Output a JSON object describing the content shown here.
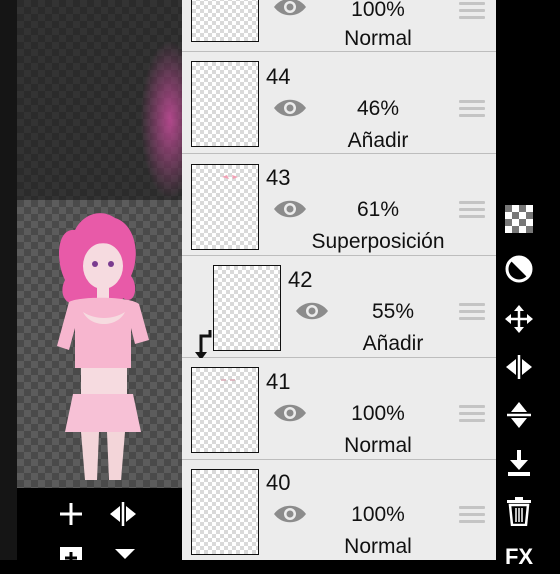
{
  "layers": [
    {
      "number": "",
      "opacity": "100%",
      "blend": "Normal"
    },
    {
      "number": "44",
      "opacity": "46%",
      "blend": "Añadir"
    },
    {
      "number": "43",
      "opacity": "61%",
      "blend": "Superposición"
    },
    {
      "number": "42",
      "opacity": "55%",
      "blend": "Añadir",
      "clipped": true
    },
    {
      "number": "41",
      "opacity": "100%",
      "blend": "Normal"
    },
    {
      "number": "40",
      "opacity": "100%",
      "blend": "Normal"
    }
  ],
  "canvas_toolbar": {
    "icons": [
      "add-layer-icon",
      "flip-horizontal-icon",
      "add-layer-copy-icon",
      "chevron-down-icon"
    ]
  },
  "right_toolbar": {
    "icons": [
      "transparency-checker-icon",
      "contrast-icon",
      "move-icon",
      "flip-horizontal-icon",
      "flip-vertical-icon",
      "merge-down-icon",
      "trash-icon",
      "fx-icon"
    ],
    "fx_label": "FX"
  },
  "colors": {
    "panel_bg": "#ececec",
    "character_hair": "#e85aa8",
    "toolbar_bg": "#000000"
  }
}
